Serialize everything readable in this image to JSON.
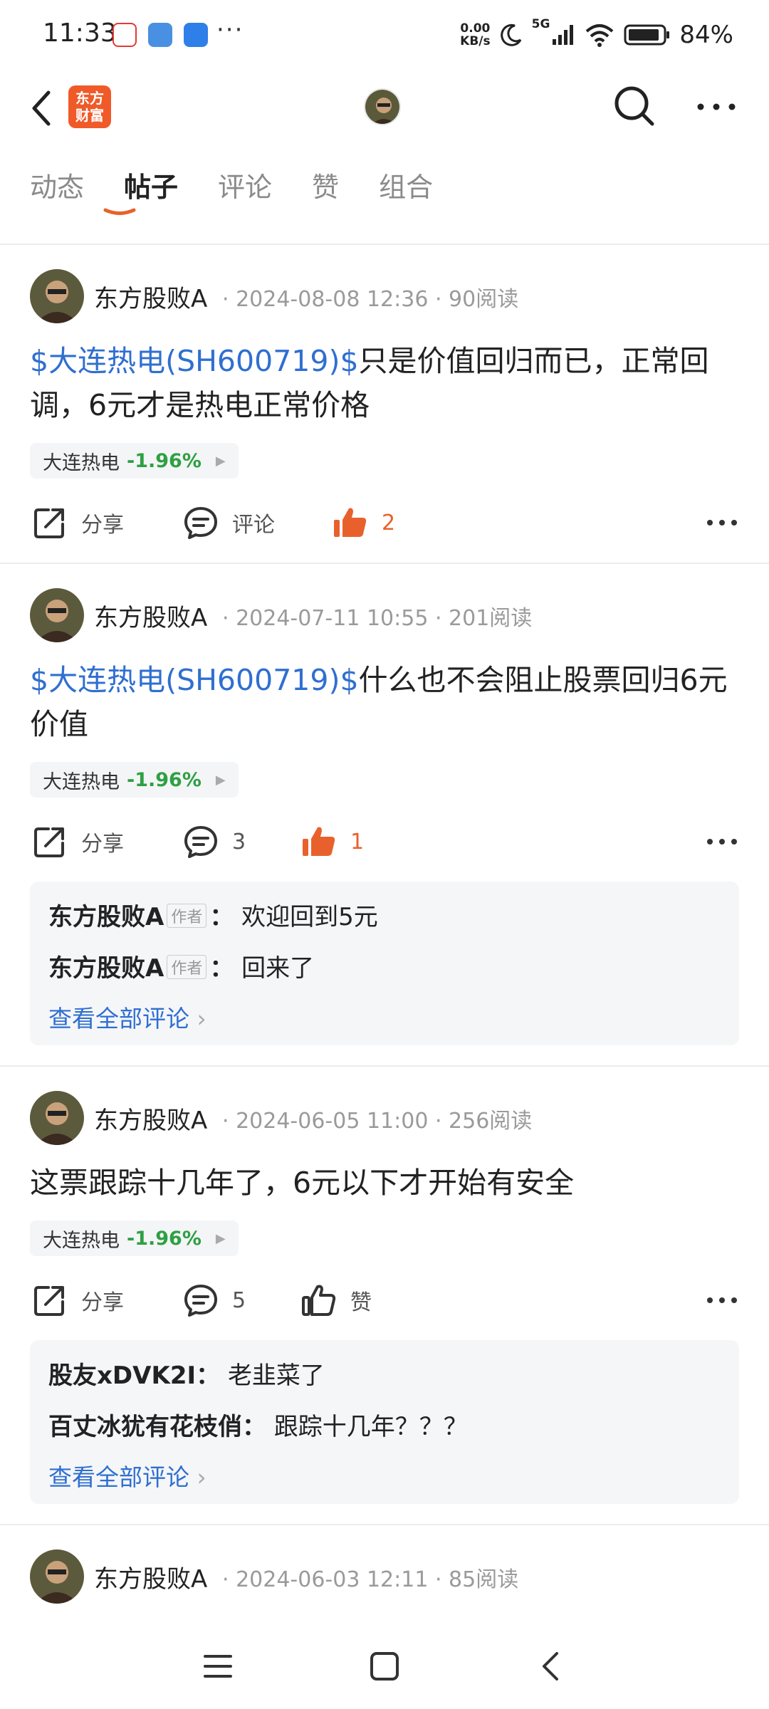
{
  "status_bar": {
    "time": "11:33",
    "net_speed_top": "0.00",
    "net_speed_bottom": "KB/s",
    "network": "5G",
    "battery": "84%",
    "more": "···"
  },
  "header": {
    "logo_text_line1": "东方",
    "logo_text_line2": "财富"
  },
  "tabs": [
    {
      "label": "动态"
    },
    {
      "label": "帖子"
    },
    {
      "label": "评论"
    },
    {
      "label": "赞"
    },
    {
      "label": "组合"
    }
  ],
  "posts": [
    {
      "author": "东方股败A",
      "date": "2024-08-08 12:36",
      "reads": "90阅读",
      "stock_link": "$大连热电(SH600719)$",
      "text": "只是价值回归而已，正常回调，6元才是热电正常价格",
      "tag_name": "大连热电",
      "tag_change": "-1.96%",
      "share_label": "分享",
      "comment_label": "评论",
      "like_label": "2"
    },
    {
      "author": "东方股败A",
      "date": "2024-07-11 10:55",
      "reads": "201阅读",
      "stock_link": "$大连热电(SH600719)$",
      "text": "什么也不会阻止股票回归6元价值",
      "tag_name": "大连热电",
      "tag_change": "-1.96%",
      "share_label": "分享",
      "comment_label": "3",
      "like_label": "1",
      "comments": [
        {
          "name": "东方股败A",
          "badge": "作者",
          "text": "欢迎回到5元"
        },
        {
          "name": "东方股败A",
          "badge": "作者",
          "text": "回来了"
        }
      ],
      "view_all": "查看全部评论"
    },
    {
      "author": "东方股败A",
      "date": "2024-06-05 11:00",
      "reads": "256阅读",
      "text": "这票跟踪十几年了，6元以下才开始有安全",
      "tag_name": "大连热电",
      "tag_change": "-1.96%",
      "share_label": "分享",
      "comment_label": "5",
      "like_label": "赞",
      "comments": [
        {
          "name": "股友xDVK2I",
          "text": "老韭菜了"
        },
        {
          "name": "百丈冰犹有花枝俏",
          "text": "跟踪十几年？？？"
        }
      ],
      "view_all": "查看全部评论"
    },
    {
      "author": "东方股败A",
      "date": "2024-06-03 12:11",
      "reads": "85阅读"
    }
  ],
  "colors": {
    "accent_orange": "#e8612c",
    "link_blue": "#2f6fd0",
    "fall_green": "#2ea043"
  }
}
